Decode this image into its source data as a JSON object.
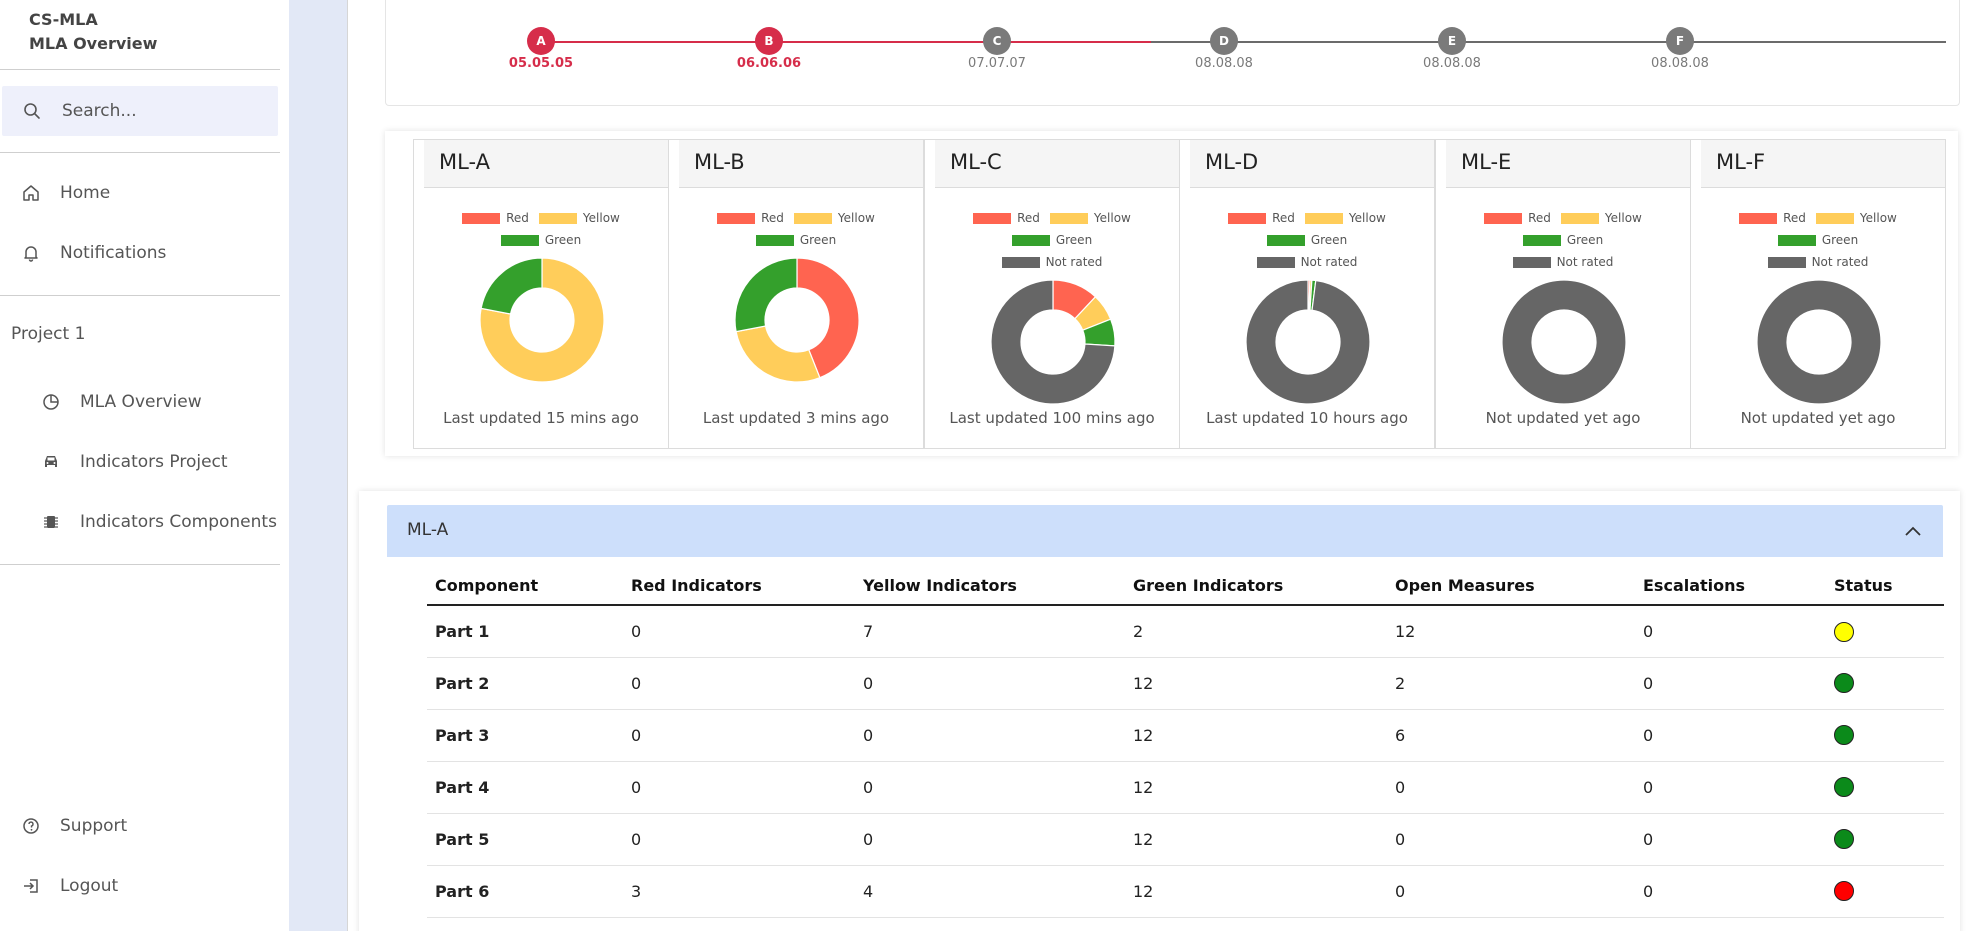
{
  "app": {
    "title_line1": "CS-MLA",
    "title_line2": "MLA Overview"
  },
  "search": {
    "placeholder": "Search..."
  },
  "nav": {
    "home": "Home",
    "notifications": "Notifications",
    "section": "Project 1",
    "mla_overview": "MLA Overview",
    "indicators_project": "Indicators Project",
    "indicators_components": "Indicators Components",
    "support": "Support",
    "logout": "Logout"
  },
  "timeline": [
    {
      "letter": "A",
      "date": "05.05.05",
      "state": "done"
    },
    {
      "letter": "B",
      "date": "06.06.06",
      "state": "done"
    },
    {
      "letter": "C",
      "date": "07.07.07",
      "state": "pending"
    },
    {
      "letter": "D",
      "date": "08.08.08",
      "state": "pending"
    },
    {
      "letter": "E",
      "date": "08.08.08",
      "state": "pending"
    },
    {
      "letter": "F",
      "date": "08.08.08",
      "state": "pending"
    }
  ],
  "colors": {
    "red": "#ff6450",
    "yellow": "#ffcd5a",
    "green": "#34a02c",
    "not_rated": "#666666",
    "timeline_done": "#d62d4a",
    "timeline_pending": "#7a7a7a",
    "status_yellow": "#ffff00",
    "status_green": "#0b8a1a",
    "status_red": "#ff0000"
  },
  "legend_labels": {
    "red": "Red",
    "yellow": "Yellow",
    "green": "Green",
    "not_rated": "Not rated"
  },
  "chart_data": [
    {
      "type": "pie",
      "title": "ML-A",
      "labels": [
        "Red",
        "Yellow",
        "Green"
      ],
      "values": [
        0,
        78,
        22
      ],
      "footer": "Last updated 15 mins ago"
    },
    {
      "type": "pie",
      "title": "ML-B",
      "labels": [
        "Red",
        "Yellow",
        "Green"
      ],
      "values": [
        44,
        28,
        28
      ],
      "footer": "Last updated 3 mins ago"
    },
    {
      "type": "pie",
      "title": "ML-C",
      "labels": [
        "Red",
        "Yellow",
        "Green",
        "Not rated"
      ],
      "values": [
        12,
        7,
        7,
        74
      ],
      "footer": "Last updated 100 mins ago"
    },
    {
      "type": "pie",
      "title": "ML-D",
      "labels": [
        "Red",
        "Yellow",
        "Green",
        "Not rated"
      ],
      "values": [
        0.5,
        0.5,
        1,
        98
      ],
      "footer": "Last updated 10 hours ago"
    },
    {
      "type": "pie",
      "title": "ML-E",
      "labels": [
        "Red",
        "Yellow",
        "Green",
        "Not rated"
      ],
      "values": [
        0,
        0,
        0,
        100
      ],
      "footer": "Not updated yet ago"
    },
    {
      "type": "pie",
      "title": "ML-F",
      "labels": [
        "Red",
        "Yellow",
        "Green",
        "Not rated"
      ],
      "values": [
        0,
        0,
        0,
        100
      ],
      "footer": "Not updated yet ago"
    }
  ],
  "accordion": {
    "title": "ML-A",
    "columns": [
      "Component",
      "Red Indicators",
      "Yellow Indicators",
      "Green Indicators",
      "Open Measures",
      "Escalations",
      "Status"
    ],
    "rows": [
      {
        "component": "Part 1",
        "red": "0",
        "yellow": "7",
        "green": "2",
        "open": "12",
        "esc": "0",
        "status": "yellow"
      },
      {
        "component": "Part 2",
        "red": "0",
        "yellow": "0",
        "green": "12",
        "open": "2",
        "esc": "0",
        "status": "green"
      },
      {
        "component": "Part 3",
        "red": "0",
        "yellow": "0",
        "green": "12",
        "open": "6",
        "esc": "0",
        "status": "green"
      },
      {
        "component": "Part 4",
        "red": "0",
        "yellow": "0",
        "green": "12",
        "open": "0",
        "esc": "0",
        "status": "green"
      },
      {
        "component": "Part 5",
        "red": "0",
        "yellow": "0",
        "green": "12",
        "open": "0",
        "esc": "0",
        "status": "green"
      },
      {
        "component": "Part 6",
        "red": "3",
        "yellow": "4",
        "green": "12",
        "open": "0",
        "esc": "0",
        "status": "red"
      }
    ]
  }
}
